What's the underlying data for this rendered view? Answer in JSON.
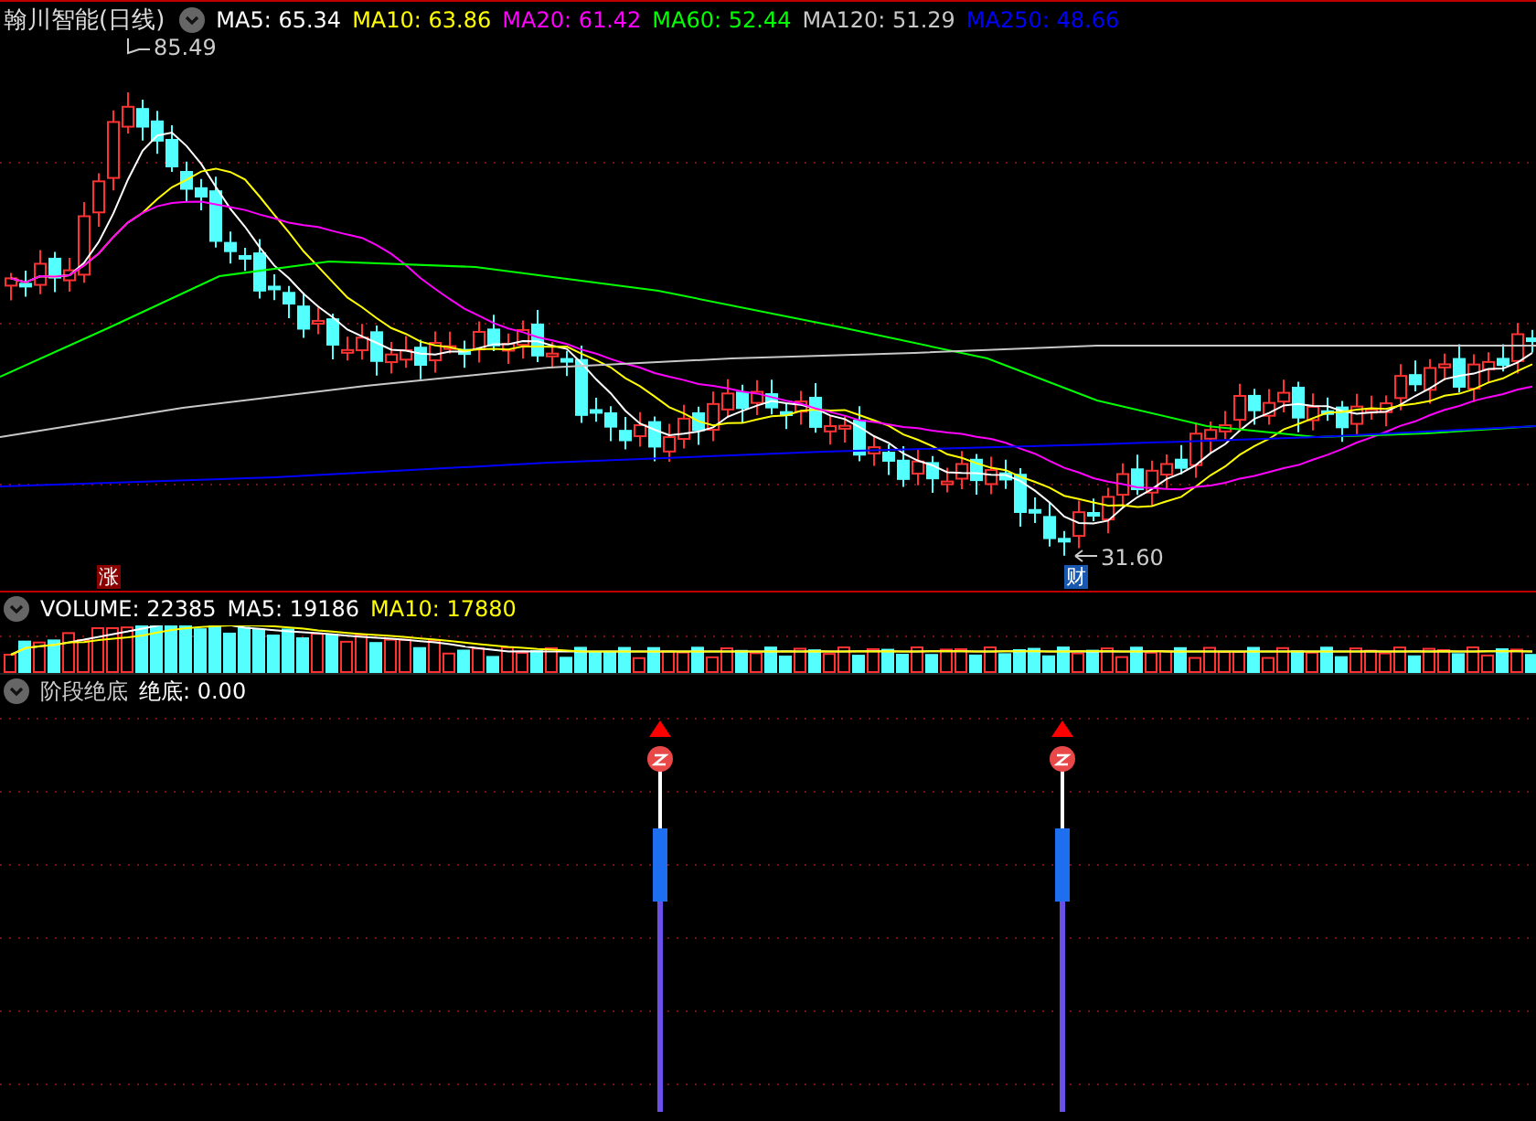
{
  "main_panel": {
    "stock_name": "翰川智能",
    "period": "(日线)",
    "ma_legend": [
      {
        "label": "MA5:",
        "value": "65.34",
        "color": "#ffffff"
      },
      {
        "label": "MA10:",
        "value": "63.86",
        "color": "#ffff00"
      },
      {
        "label": "MA20:",
        "value": "61.42",
        "color": "#ff00ff"
      },
      {
        "label": "MA60:",
        "value": "52.44",
        "color": "#00ff00"
      },
      {
        "label": "MA120:",
        "value": "51.29",
        "color": "#c8c8c8"
      },
      {
        "label": "MA250:",
        "value": "48.66",
        "color": "#0000ff"
      }
    ],
    "high_label": "85.49",
    "low_label": "31.60",
    "tags": [
      {
        "text": "涨",
        "kind": "limit"
      },
      {
        "text": "财",
        "kind": "report"
      }
    ]
  },
  "volume_panel": {
    "legend": [
      {
        "label": "VOLUME:",
        "value": "22385",
        "color": "#ffffff"
      },
      {
        "label": "MA5:",
        "value": "19186",
        "color": "#ffffff"
      },
      {
        "label": "MA10:",
        "value": "17880",
        "color": "#ffff00"
      }
    ]
  },
  "indicator_panel": {
    "name": "阶段绝底",
    "legend": [
      {
        "label": "绝底:",
        "value": "0.00",
        "color": "#ffffff"
      }
    ]
  }
}
